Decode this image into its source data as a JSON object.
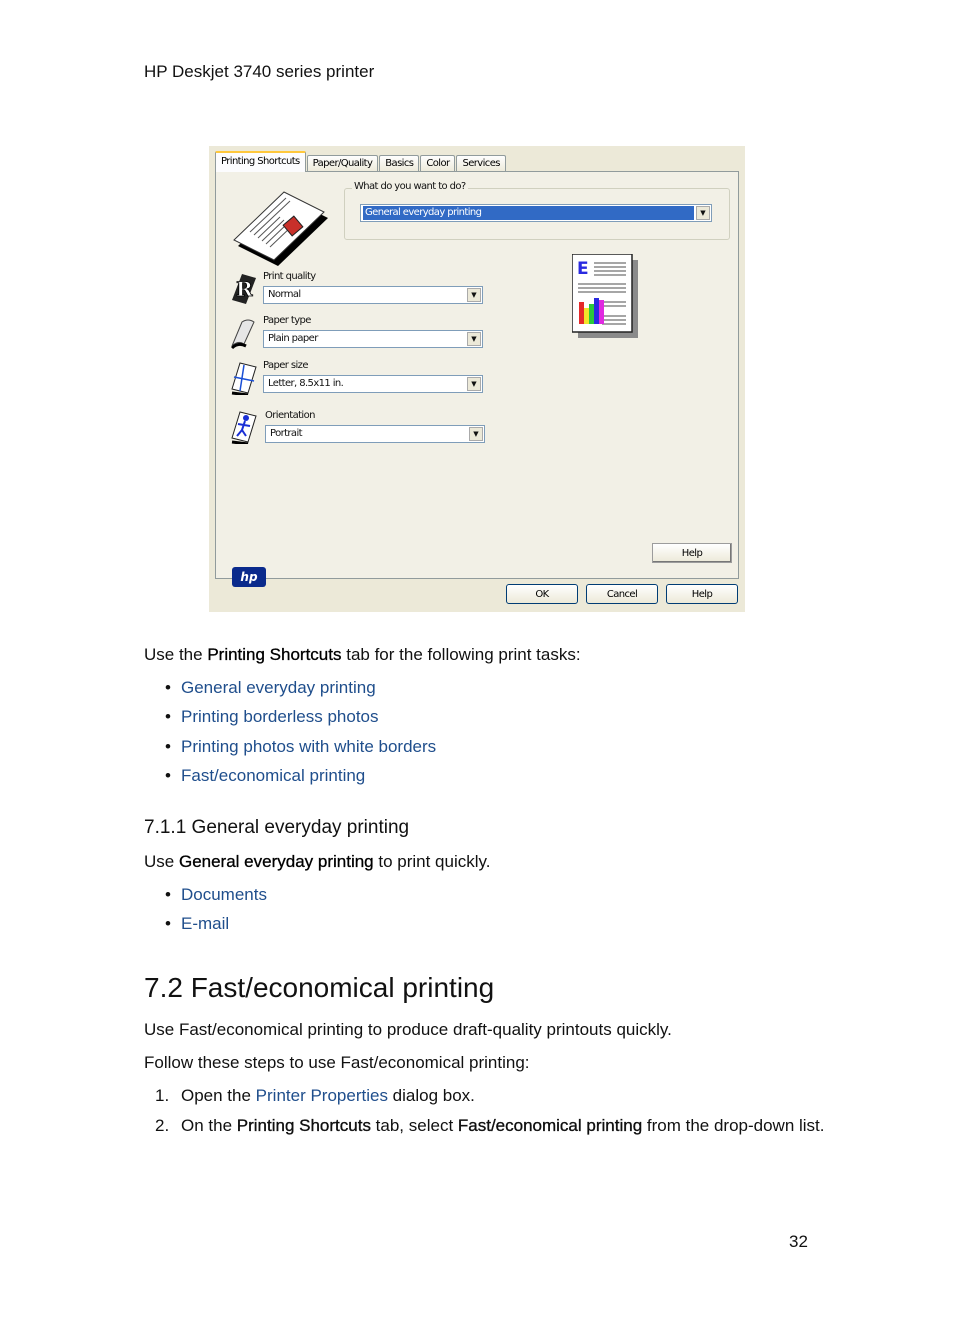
{
  "header": {
    "running_title": "HP Deskjet 3740 series printer"
  },
  "dialog": {
    "tabs": [
      "Printing Shortcuts",
      "Paper/Quality",
      "Basics",
      "Color",
      "Services"
    ],
    "active_tab": "Printing Shortcuts",
    "task_group_label": "What do you want to do?",
    "task_selected": "General everyday printing",
    "fields": [
      {
        "label": "Print quality",
        "value": "Normal",
        "icon": "print-quality-icon"
      },
      {
        "label": "Paper type",
        "value": "Plain paper",
        "icon": "paper-type-icon"
      },
      {
        "label": "Paper size",
        "value": "Letter, 8.5x11 in.",
        "icon": "paper-size-icon"
      },
      {
        "label": "Orientation",
        "value": "Portrait",
        "icon": "orientation-icon"
      }
    ],
    "logo_text": "hp",
    "inner_help_label": "Help",
    "buttons": {
      "ok": "OK",
      "cancel": "Cancel",
      "help": "Help"
    },
    "colors": {
      "selection": "#316ac5",
      "face": "#ece9d8",
      "active_tab_accent": "#ffc83c"
    }
  },
  "intro": {
    "prefix": "Use the ",
    "bold": "Printing Shortcuts",
    "suffix": " tab for the following print tasks:",
    "links": [
      "General everyday printing",
      "Printing borderless photos",
      "Printing photos with white borders",
      "Fast/economical printing"
    ]
  },
  "section_711": {
    "heading": "7.1.1  General everyday printing",
    "para_prefix": "Use ",
    "para_bold": "General everyday printing",
    "para_suffix": " to print quickly.",
    "links": [
      "Documents",
      "E-mail"
    ]
  },
  "section_72": {
    "heading": "7.2  Fast/economical printing",
    "para1": "Use Fast/economical printing to produce draft-quality printouts quickly.",
    "para2": "Follow these steps to use Fast/economical printing:",
    "steps": [
      {
        "num": "1.",
        "pre": "Open the ",
        "link": "Printer Properties",
        "post": " dialog box."
      },
      {
        "num": "2.",
        "pre": "On the ",
        "bold1": "Printing Shortcuts",
        "mid": " tab, select ",
        "bold2": "Fast/economical printing",
        "post": " from the drop-down list."
      }
    ]
  },
  "footer": {
    "page_number": "32"
  },
  "colors": {
    "link": "#1f4e8c",
    "text": "#111111"
  }
}
